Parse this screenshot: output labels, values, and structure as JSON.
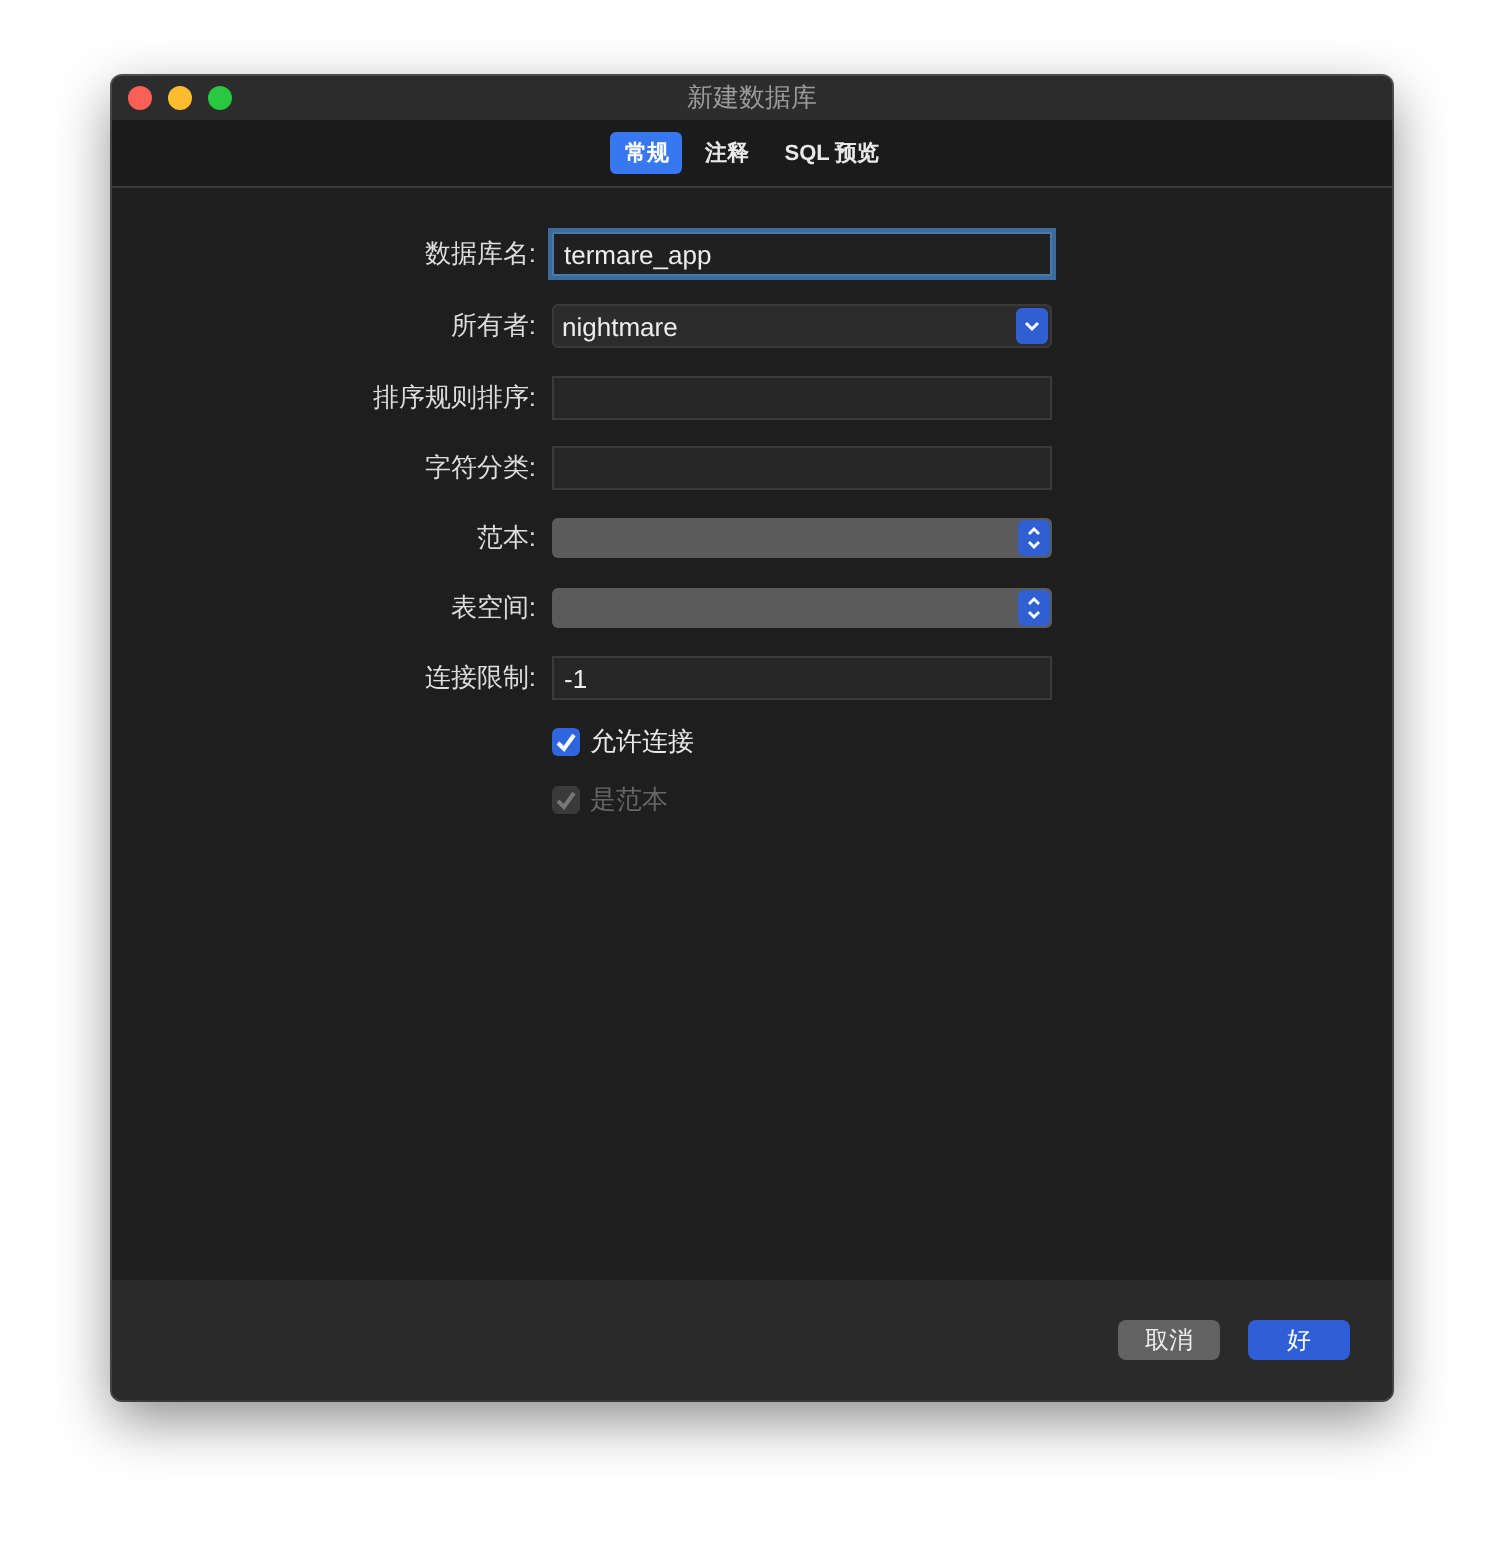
{
  "window": {
    "title": "新建数据库"
  },
  "tabs": [
    {
      "label": "常规",
      "selected": true
    },
    {
      "label": "注释",
      "selected": false
    },
    {
      "label": "SQL 预览",
      "selected": false
    }
  ],
  "fields": [
    {
      "label": "数据库名:",
      "kind": "text",
      "value": "termare_app",
      "focused": true
    },
    {
      "label": "所有者:",
      "kind": "popup",
      "value": "nightmare"
    },
    {
      "label": "排序规则排序:",
      "kind": "text",
      "focused": false
    },
    {
      "label": "字符分类:",
      "kind": "text",
      "focused": false
    },
    {
      "label": "范本:",
      "kind": "select"
    },
    {
      "label": "表空间:",
      "kind": "select"
    },
    {
      "label": "连接限制:",
      "kind": "text",
      "value": "-1",
      "focused": false
    }
  ],
  "checkboxes": [
    {
      "label": "允许连接",
      "checked": true,
      "disabled": false
    },
    {
      "label": "是范本",
      "checked": true,
      "disabled": true
    }
  ],
  "buttons": [
    {
      "label": "取消",
      "kind": "cancel"
    },
    {
      "label": "好",
      "kind": "default"
    }
  ]
}
